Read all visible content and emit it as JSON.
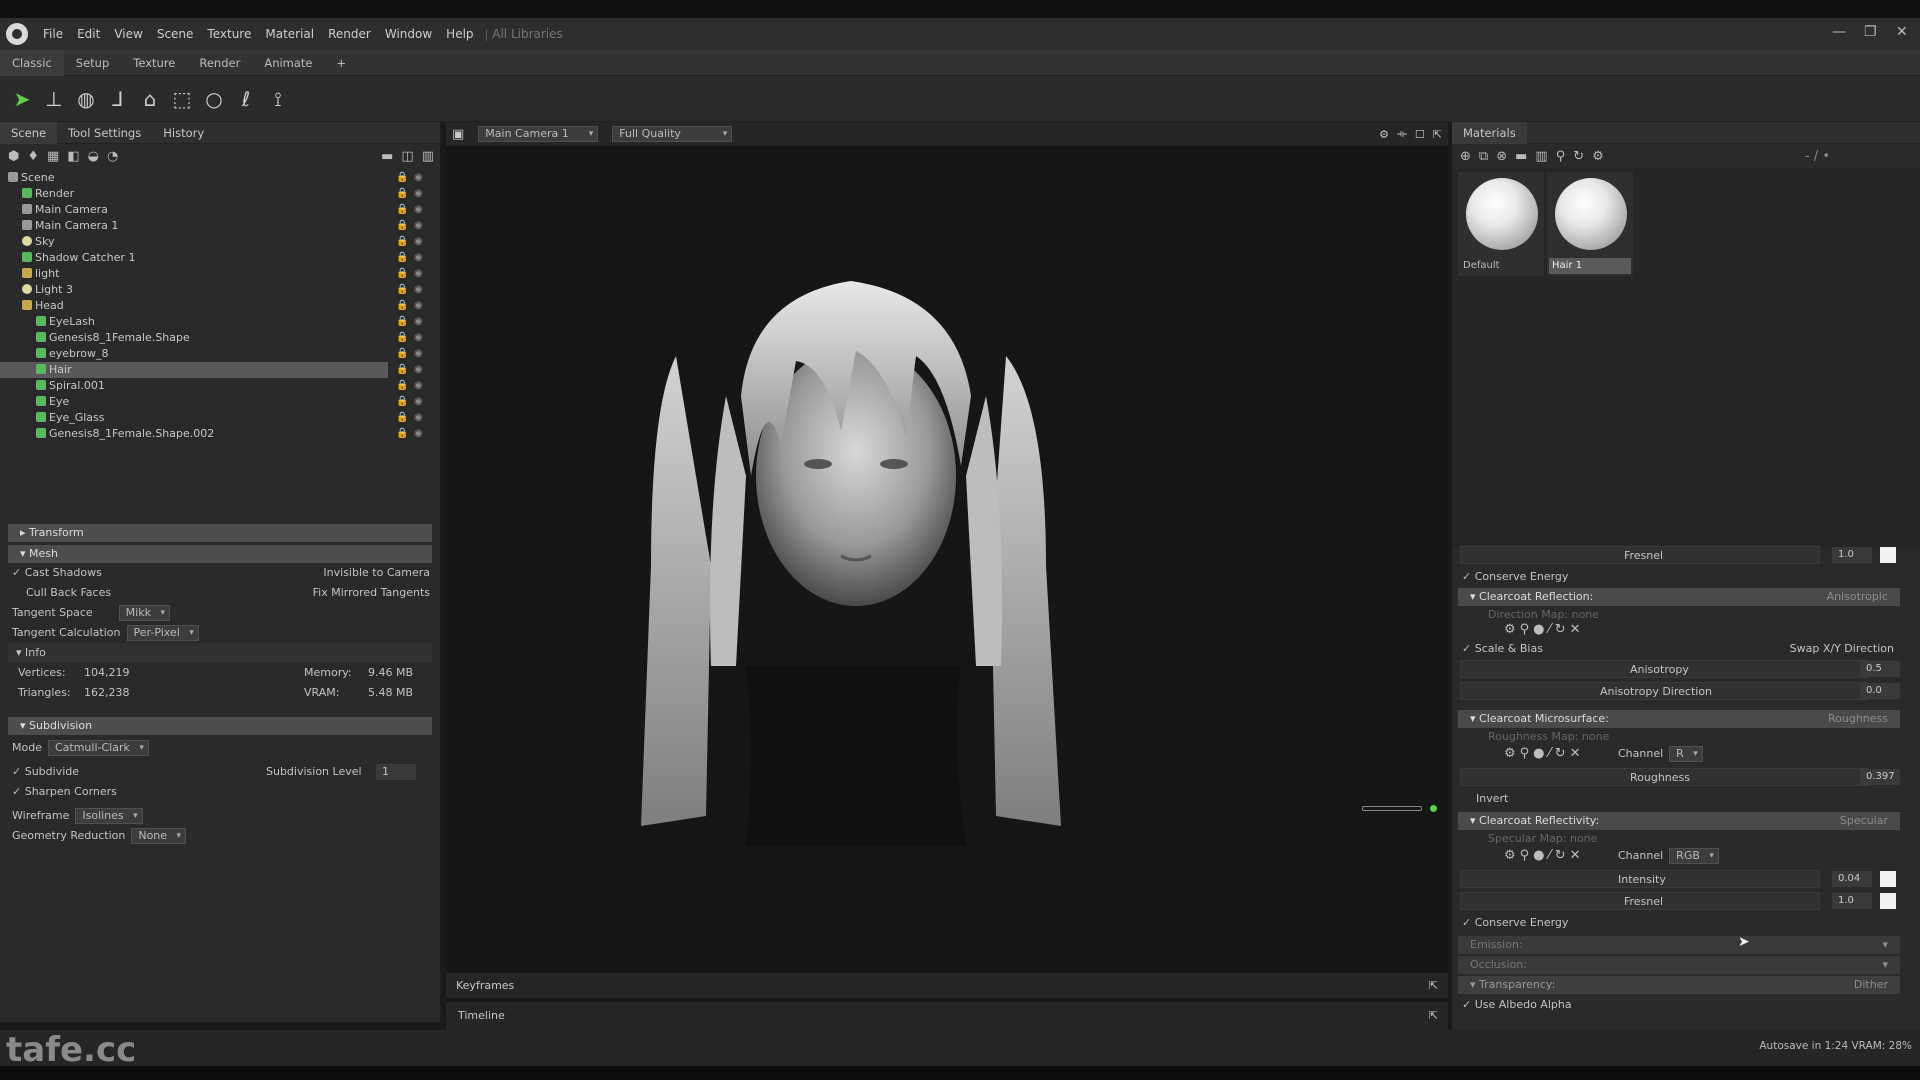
{
  "app": {
    "menu": [
      "File",
      "Edit",
      "View",
      "Scene",
      "Texture",
      "Material",
      "Render",
      "Window",
      "Help"
    ],
    "document": "All Libraries",
    "window_controls": [
      "—",
      "❐",
      "✕"
    ]
  },
  "workspace_tabs": [
    "Classic",
    "Setup",
    "Texture",
    "Render",
    "Animate",
    "+"
  ],
  "toolbar": {
    "tools": [
      "select-arrow-icon",
      "transform-icon",
      "rotate-icon",
      "move-axis-icon",
      "paint-icon",
      "marquee-select-icon",
      "circle-select-icon",
      "lasso-select-icon",
      "freeform-select-icon"
    ]
  },
  "left_panel": {
    "tabs": [
      "Scene",
      "Tool Settings",
      "History"
    ],
    "tree": [
      {
        "label": "Scene",
        "indent": 0,
        "icon": "scene"
      },
      {
        "label": "Render",
        "indent": 1,
        "icon": "obj"
      },
      {
        "label": "Main Camera",
        "indent": 1,
        "icon": "cam"
      },
      {
        "label": "Main Camera 1",
        "indent": 1,
        "icon": "cam"
      },
      {
        "label": "Sky",
        "indent": 1,
        "icon": "light"
      },
      {
        "label": "Shadow Catcher 1",
        "indent": 1,
        "icon": "obj"
      },
      {
        "label": "light",
        "indent": 1,
        "icon": "fold"
      },
      {
        "label": "Light 3",
        "indent": 1,
        "icon": "light"
      },
      {
        "label": "Head",
        "indent": 1,
        "icon": "fold"
      },
      {
        "label": "EyeLash",
        "indent": 2,
        "icon": "obj"
      },
      {
        "label": "Genesis8_1Female.Shape",
        "indent": 2,
        "icon": "obj"
      },
      {
        "label": "eyebrow_8",
        "indent": 2,
        "icon": "obj"
      },
      {
        "label": "Hair",
        "indent": 2,
        "icon": "obj",
        "selected": true
      },
      {
        "label": "Spiral.001",
        "indent": 2,
        "icon": "obj"
      },
      {
        "label": "Eye",
        "indent": 2,
        "icon": "obj"
      },
      {
        "label": "Eye_Glass",
        "indent": 2,
        "icon": "obj"
      },
      {
        "label": "Genesis8_1Female.Shape.002",
        "indent": 2,
        "icon": "obj"
      }
    ],
    "transform_label": "Transform",
    "mesh_label": "Mesh",
    "cast_shadows": "Cast Shadows",
    "invisible_to_camera": "Invisible to Camera",
    "cull_back_faces": "Cull Back Faces",
    "fix_mirrored": "Fix Mirrored Tangents",
    "tangent_space_label": "Tangent Space",
    "tangent_space_value": "Mikk",
    "tangent_calc_label": "Tangent Calculation",
    "tangent_calc_value": "Per-Pixel",
    "info_label": "Info",
    "vertices_label": "Vertices:",
    "vertices_value": "104,219",
    "triangles_label": "Triangles:",
    "triangles_value": "162,238",
    "memory_label": "Memory:",
    "memory_value": "9.46 MB",
    "vram_label": "VRAM:",
    "vram_value": "5.48 MB",
    "subdivision_label": "Subdivision",
    "mode_label": "Mode",
    "mode_value": "Catmull-Clark",
    "subdivide": "Subdivide",
    "subdivision_level_label": "Subdivision Level",
    "subdivision_level_value": "1",
    "sharpen_corners": "Sharpen Corners",
    "wireframe_label": "Wireframe",
    "wireframe_value": "Isolines",
    "geo_reduction_label": "Geometry Reduction",
    "geo_reduction_value": "None"
  },
  "viewport": {
    "camera": "Main Camera 1",
    "quality": "Full Quality",
    "keyframes_label": "Keyframes",
    "timeline_label": "Timeline"
  },
  "materials": {
    "title": "Materials",
    "swatches": [
      {
        "label": "Default"
      },
      {
        "label": "Hair 1",
        "selected": true
      }
    ],
    "fresnel_label": "Fresnel",
    "fresnel_value": "1.0",
    "conserve_energy": "Conserve Energy",
    "clearcoat_reflection": "Clearcoat Reflection:",
    "clearcoat_reflection_mode": "Anisotropic",
    "direction_map": "Direction Map: none",
    "scale_bias": "Scale & Bias",
    "swap_xy": "Swap X/Y Direction",
    "anisotropy_label": "Anisotropy",
    "anisotropy_value": "0.5",
    "aniso_dir_label": "Anisotropy Direction",
    "aniso_dir_value": "0.0",
    "clearcoat_micro": "Clearcoat Microsurface:",
    "clearcoat_micro_mode": "Roughness",
    "roughness_map": "Roughness Map: none",
    "channel_label": "Channel",
    "channel_r": "R",
    "roughness_label": "Roughness",
    "roughness_value": "0.397",
    "invert": "Invert",
    "clearcoat_reflectivity": "Clearcoat Reflectivity:",
    "clearcoat_reflectivity_mode": "Specular",
    "specular_map": "Specular Map: none",
    "channel_rgb": "RGB",
    "intensity_label": "Intensity",
    "intensity_value": "0.04",
    "fresnel2_value": "1.0",
    "emission": "Emission:",
    "occlusion": "Occlusion:",
    "transparency": "Transparency:",
    "transparency_mode": "Dither",
    "use_albedo_alpha": "Use Albedo Alpha",
    "slash_label": "- / •"
  },
  "status": {
    "text": "Autosave in 1:24   VRAM: 28%",
    "watermark": "tafe.cc"
  },
  "colors": {
    "accent_green": "#5fd14a",
    "panel_bg": "#2a2a2a",
    "section_header": "#4d4d4d"
  }
}
